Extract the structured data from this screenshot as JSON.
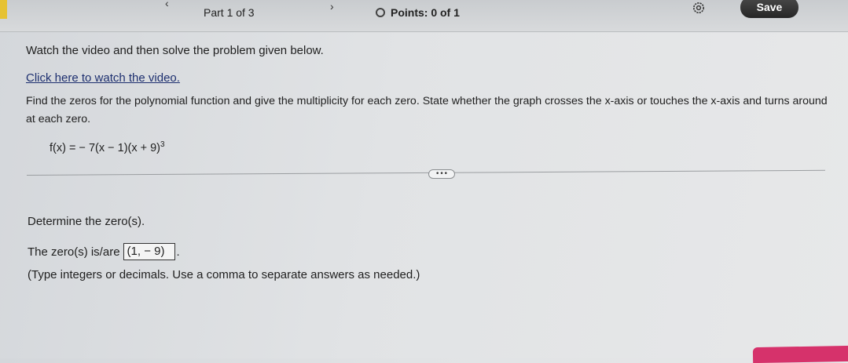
{
  "header": {
    "prev_arrow": "‹",
    "next_arrow": "›",
    "part_label": "Part 1 of 3",
    "points_label": "Points: 0 of 1",
    "save_label": "Save"
  },
  "question": {
    "instruction": "Watch the video and then solve the problem given below.",
    "video_link": "Click here to watch the video.",
    "problem_text": "Find the zeros for the polynomial function and give the multiplicity for each zero. State whether the graph crosses the x-axis or touches the x-axis and turns around at each zero.",
    "function_base": "f(x) = − 7(x − 1)(x + 9)",
    "function_exponent": "3",
    "more_button": "•••"
  },
  "part": {
    "prompt": "Determine the zero(s).",
    "answer_label": "The zero(s) is/are",
    "answer_value": "(1, − 9)",
    "answer_suffix": ".",
    "hint": "(Type integers or decimals. Use a comma to separate answers as needed.)"
  },
  "colors": {
    "save_button": "#2e2e2e",
    "link": "#1d2f6f",
    "accent_bottom": "#d6326b",
    "yellow_tab": "#e6c233"
  }
}
